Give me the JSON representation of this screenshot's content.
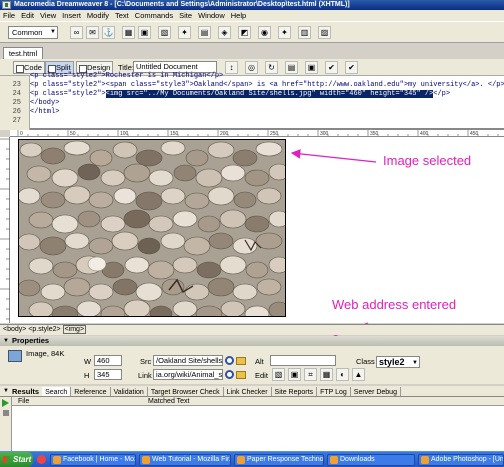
{
  "window": {
    "title": "Macromedia Dreamweaver 8 - [C:\\Documents and Settings\\Administrator\\Desktop\\test.html (XHTML)]"
  },
  "menu": [
    "File",
    "Edit",
    "View",
    "Insert",
    "Modify",
    "Text",
    "Commands",
    "Site",
    "Window",
    "Help"
  ],
  "insert_bar": {
    "category": "Common"
  },
  "document": {
    "tab": "test.html",
    "views": {
      "code": "Code",
      "split": "Split",
      "design": "Design"
    },
    "title_label": "Title:",
    "title_value": "Untitled Document"
  },
  "code": {
    "partial_top": "<p class=\"style2\">Rochester is in Michigan</p>",
    "lines": [
      {
        "num": "23",
        "text": "<p class=\"style2\"><span class=\"style3\">Oakland</span> is <a href=\"http://www.oakland.edu\">my university</a>. </p>"
      },
      {
        "num": "24",
        "before": "<p class=\"style2\">",
        "selected": "<img src=\"../My Documents/Oakland Site/shells.jpg\" width=\"460\" height=\"345\" />",
        "after": "</p>"
      },
      {
        "num": "25",
        "text": "</body>"
      },
      {
        "num": "26",
        "text": "</html>"
      },
      {
        "num": "27",
        "text": ""
      }
    ]
  },
  "ruler": {
    "ticks": [
      "0",
      "50",
      "100",
      "150",
      "200",
      "250",
      "300",
      "350",
      "400",
      "450",
      "500"
    ]
  },
  "status": {
    "tags": [
      "<body>",
      "<p.style2>",
      "<img>"
    ]
  },
  "annotations": {
    "image_selected": "Image selected",
    "web_address": "Web address entered"
  },
  "properties": {
    "header": "Properties",
    "image_label": "Image, 84K",
    "w_label": "W",
    "w_value": "460",
    "h_label": "H",
    "h_value": "345",
    "src_label": "Src",
    "src_value": "/Oakland Site/shells.jpg",
    "link_label": "Link",
    "link_value": "ia.org/wiki/Animal_shell",
    "alt_label": "Alt",
    "edit_label": "Edit",
    "class_label": "Class",
    "class_value": "style2"
  },
  "results": {
    "header": "Results",
    "tabs": [
      "Search",
      "Reference",
      "Validation",
      "Target Browser Check",
      "Link Checker",
      "Site Reports",
      "FTP Log",
      "Server Debug"
    ],
    "col_file": "File",
    "col_matched": "Matched Text"
  },
  "taskbar": {
    "start": "Start",
    "items": [
      "Facebook | Home - Mozill...",
      "Web Tutorial - Mozilla Fir...",
      "Paper Response Technol...",
      "Downloads",
      "Adobe Photoshop - [Unti..."
    ]
  }
}
